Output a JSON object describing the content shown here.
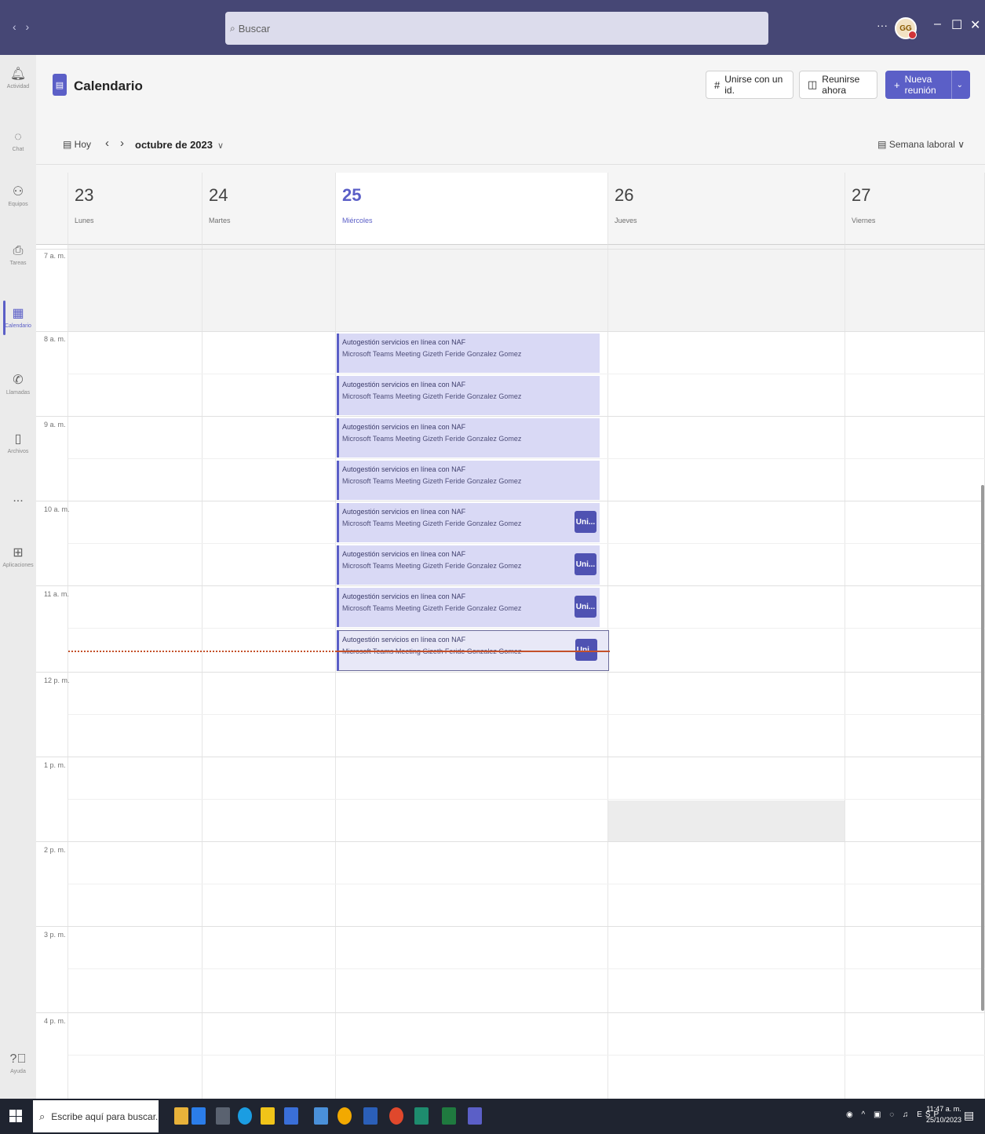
{
  "titlebar": {
    "nav_arrows": "‹ ›",
    "search_placeholder": "Buscar",
    "more": "···",
    "avatar_initials": "GG",
    "minimize": "–",
    "restore": "☐",
    "close": "✕"
  },
  "rail": {
    "items": [
      {
        "label": "Actividad",
        "icon": "bell-icon"
      },
      {
        "label": "Chat",
        "icon": "chat-icon"
      },
      {
        "label": "Equipos",
        "icon": "teams-icon"
      },
      {
        "label": "Tareas",
        "icon": "tasks-icon"
      },
      {
        "label": "Calendario",
        "icon": "calendar-icon"
      },
      {
        "label": "Llamadas",
        "icon": "phone-icon"
      },
      {
        "label": "Archivos",
        "icon": "file-icon"
      },
      {
        "label": "...",
        "icon": "more-icon"
      },
      {
        "label": "Aplicaciones",
        "icon": "apps-icon"
      },
      {
        "label": "Ayuda",
        "icon": "help-icon"
      }
    ],
    "active": "Calendario"
  },
  "header": {
    "title": "Calendario",
    "join_id_label": "Unirse con un id.",
    "meet_now_label": "Reunirse ahora",
    "new_meeting_label": "Nueva reunión"
  },
  "toolbar": {
    "today_label": "Hoy",
    "month_label": "octubre de 2023",
    "view_label": "Semana laboral"
  },
  "days": [
    {
      "num": "23",
      "name": "Lunes"
    },
    {
      "num": "24",
      "name": "Martes"
    },
    {
      "num": "25",
      "name": "Miércoles"
    },
    {
      "num": "26",
      "name": "Jueves"
    },
    {
      "num": "27",
      "name": "Viernes"
    }
  ],
  "hours": [
    "7 a. m.",
    "8 a. m.",
    "9 a. m.",
    "10 a. m.",
    "11 a. m.",
    "12 p. m.",
    "1 p. m.",
    "2 p. m.",
    "3 p. m.",
    "4 p. m."
  ],
  "event": {
    "title": "Autogestión servicios en línea con NAF",
    "subtitle": "Microsoft Teams Meeting  Gizeth Feride Gonzalez Gomez",
    "join_label": "Uni..."
  },
  "taskbar": {
    "search_placeholder": "Escribe aquí para buscar.",
    "tray_text": "ESP",
    "time": "11:47 a. m.",
    "date": "25/10/2023"
  },
  "colors": {
    "accent": "#5b5fc7",
    "titlebar": "#464775",
    "event_bg": "#d9d9f5",
    "now_line": "#c4502a"
  }
}
